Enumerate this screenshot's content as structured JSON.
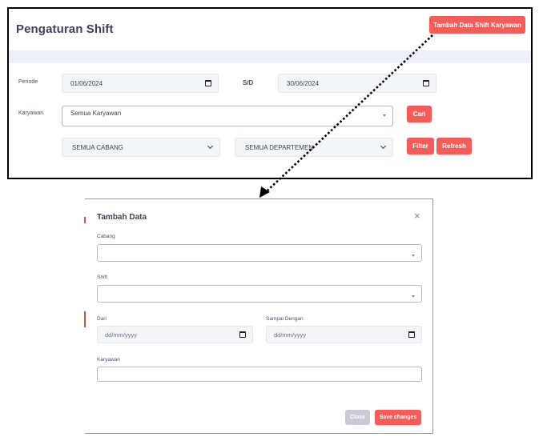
{
  "header": {
    "title": "Pengaturan Shift",
    "add_button": "Tambah Data Shift Karyawan"
  },
  "filters": {
    "periode_label": "Periode",
    "date_from": "01/06/2024",
    "sd_label": "S/D",
    "date_to": "30/06/2024",
    "karyawan_label": "Karyawan",
    "karyawan_value": "Semua Karyawan",
    "cari_button": "Cari",
    "cabang_value": "SEMUA CABANG",
    "departemen_value": "SEMUA DEPARTEMEN",
    "filter_button": "Filter",
    "refresh_button": "Refresh"
  },
  "modal": {
    "title": "Tambah Data",
    "close_icon": "×",
    "cabang_label": "Cabang",
    "cabang_value": "",
    "shift_label": "Shift",
    "shift_value": "",
    "dari_label": "Dari",
    "dari_placeholder": "dd/mm/yyyy",
    "sampai_label": "Sampai Dengan",
    "sampai_placeholder": "dd/mm/yyyy",
    "karyawan_label": "Karyawan",
    "karyawan_value": "",
    "close_button": "Close",
    "save_button": "Save changes"
  },
  "colors": {
    "accent": "#f05d5a",
    "title": "#3f4060",
    "input_bg": "#f3f6f9",
    "band": "#eef0f8"
  },
  "icons": {
    "calendar": "calendar-icon",
    "chevron": "chevron-down-icon",
    "caret": "caret-down-icon",
    "close": "close-icon"
  }
}
